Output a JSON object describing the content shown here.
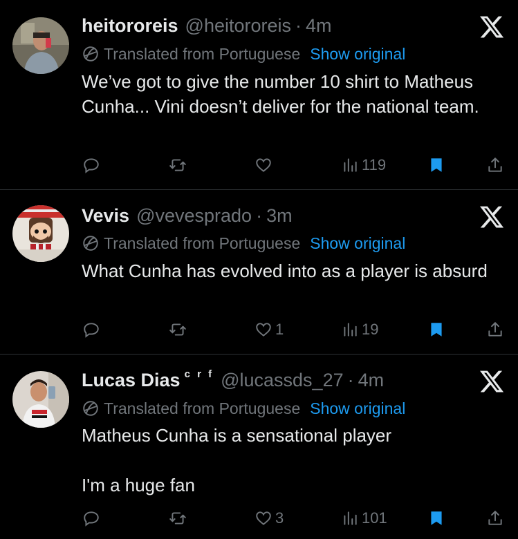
{
  "colors": {
    "background": "#000000",
    "text_primary": "#e7e9ea",
    "text_secondary": "#71767b",
    "link": "#1d9bf0",
    "divider": "#2f3336",
    "bookmark_active": "#1d9bf0"
  },
  "tweets": [
    {
      "display_name": "heitororeis",
      "badge": "",
      "handle": "@heitororeis",
      "dot": "·",
      "time": "4m",
      "translated_label": "Translated from Portuguese",
      "show_original_label": "Show original",
      "text": "We’ve got to give the number 10 shirt to Matheus Cunha... Vini doesn’t deliver for the national team.",
      "likes": "",
      "views": "119",
      "bookmarked": true
    },
    {
      "display_name": "Vevis",
      "badge": "",
      "handle": "@vevesprado",
      "dot": "·",
      "time": "3m",
      "translated_label": "Translated from Portuguese",
      "show_original_label": "Show original",
      "text": "What Cunha has evolved into as a player is absurd",
      "likes": "1",
      "views": "19",
      "bookmarked": true
    },
    {
      "display_name": "Lucas Dias",
      "badge": "c r f",
      "handle": "@lucassds_27",
      "dot": "·",
      "time": "4m",
      "translated_label": "Translated from Portuguese",
      "show_original_label": "Show original",
      "text": "Matheus Cunha is a sensational player\n\nI'm a huge fan",
      "likes": "3",
      "views": "101",
      "bookmarked": true
    }
  ],
  "icons": {
    "platform_logo": "x-logo-icon",
    "translate": "translate-globe-icon",
    "reply": "reply-icon",
    "retweet": "retweet-icon",
    "like": "heart-icon",
    "views": "views-icon",
    "bookmark": "bookmark-icon",
    "share": "share-icon"
  }
}
